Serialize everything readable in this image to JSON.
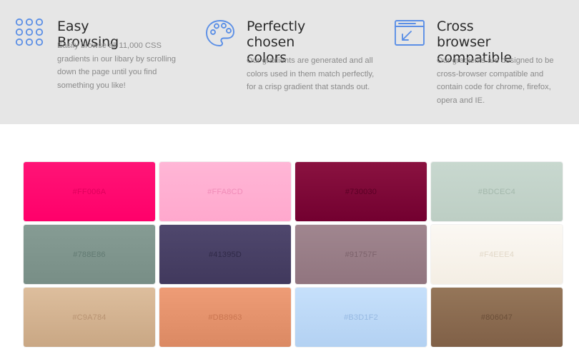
{
  "features": [
    {
      "icon": "grid-dots-icon",
      "title": "Easy Browsing",
      "desc_lines": [
        "Easily browse all 11,000 CSS",
        "gradients in our libary by scrolling",
        "down the page until you find",
        "something you like!"
      ]
    },
    {
      "icon": "palette-icon",
      "title_lines": [
        "Perfectly chosen",
        "colors"
      ],
      "desc_lines": [
        "Our gradients are generated and all",
        "colors used in them match perfectly,",
        "for a crisp gradient that stands out."
      ]
    },
    {
      "icon": "browser-window-icon",
      "title_lines": [
        "Cross browser",
        "compatible"
      ],
      "desc_lines": [
        "Our gradients are designed to be",
        "cross-browser compatible and",
        "contain code for chrome, firefox,",
        "opera and IE."
      ]
    }
  ],
  "accent_color": "#5b8fe6",
  "gradients": [
    {
      "code": "#FF006A",
      "top": "#ff1476",
      "bottom": "#ff006a",
      "text": "#e0005c"
    },
    {
      "code": "#FFA8CD",
      "top": "#ffb6d6",
      "bottom": "#ffa8cd",
      "text": "#f08cb8"
    },
    {
      "code": "#730030",
      "top": "#8a1240",
      "bottom": "#730030",
      "text": "#5a0024"
    },
    {
      "code": "#BDCEC4",
      "top": "#c8d8cf",
      "bottom": "#bdcec4",
      "text": "#a4b8ac"
    },
    {
      "code": "#788E86",
      "top": "#869c94",
      "bottom": "#788e86",
      "text": "#627a72"
    },
    {
      "code": "#41395D",
      "top": "#4f476d",
      "bottom": "#41395d",
      "text": "#302a48"
    },
    {
      "code": "#91757F",
      "top": "#a0868f",
      "bottom": "#91757f",
      "text": "#7c626b"
    },
    {
      "code": "#F4EEE4",
      "top": "#fbf8f3",
      "bottom": "#f4eee4",
      "text": "#e2d8c8"
    },
    {
      "code": "#C9A784",
      "top": "#ddbe9d",
      "bottom": "#c9a784",
      "text": "#b89372"
    },
    {
      "code": "#DB8963",
      "top": "#ee9c76",
      "bottom": "#db8963",
      "text": "#c97550"
    },
    {
      "code": "#B3D1F2",
      "top": "#c6e0fb",
      "bottom": "#b3d1f2",
      "text": "#96b9e2"
    },
    {
      "code": "#806047",
      "top": "#957659",
      "bottom": "#806047",
      "text": "#6a4e38"
    }
  ]
}
